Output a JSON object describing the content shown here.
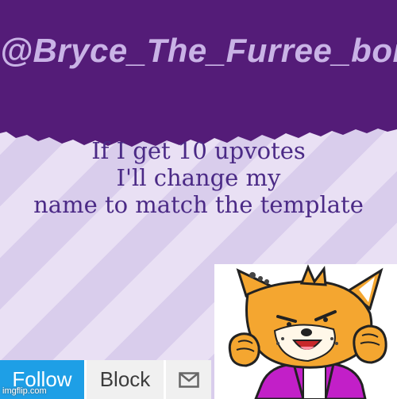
{
  "banner": {
    "username": "@Bryce_The_Furree_boi",
    "color": "#541c78"
  },
  "caption": {
    "lines": [
      "If I get 10 upvotes",
      "I'll change my",
      "name to match the template"
    ],
    "color": "#4b2a86"
  },
  "profile_buttons": {
    "follow": "Follow",
    "block": "Block",
    "message_icon": "envelope-icon",
    "follow_color": "#1e9fe6"
  },
  "sticker": {
    "description_icon": "furry-character-sticker"
  },
  "watermark": "imgflip.com"
}
